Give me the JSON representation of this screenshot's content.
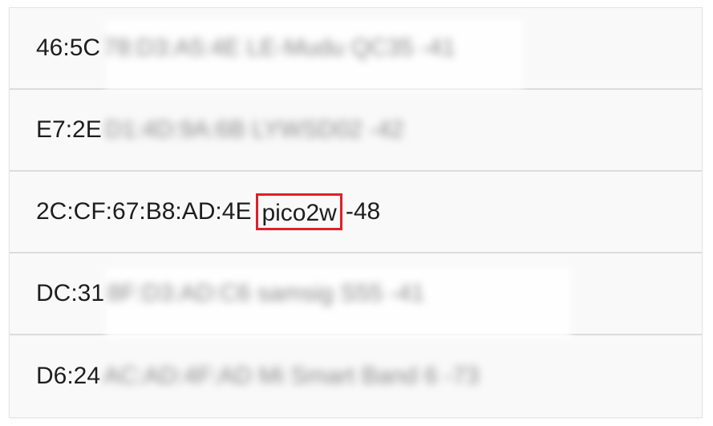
{
  "devices": [
    {
      "visible": "46:5C",
      "redacted": "78:D3:A5:4E LE-Mudu QC35 -41"
    },
    {
      "visible": "E7:2E",
      "redacted": "D1:4D:9A:6B LYWSD02 -42"
    },
    {
      "visible": "2C:CF:67:B8:AD:4E",
      "name": "pico2w",
      "rssi": "-48"
    },
    {
      "visible": "DC:31",
      "redacted": "8F:D3:AD:C6 samsig S55 -41"
    },
    {
      "visible": "D6:24",
      "redacted": "AC:AD:4F:AD Mi Smart Band 6 -73"
    }
  ],
  "colors": {
    "highlight": "#e0202a",
    "row_background": "#f9f9f9",
    "divider": "#dcdcdc"
  }
}
